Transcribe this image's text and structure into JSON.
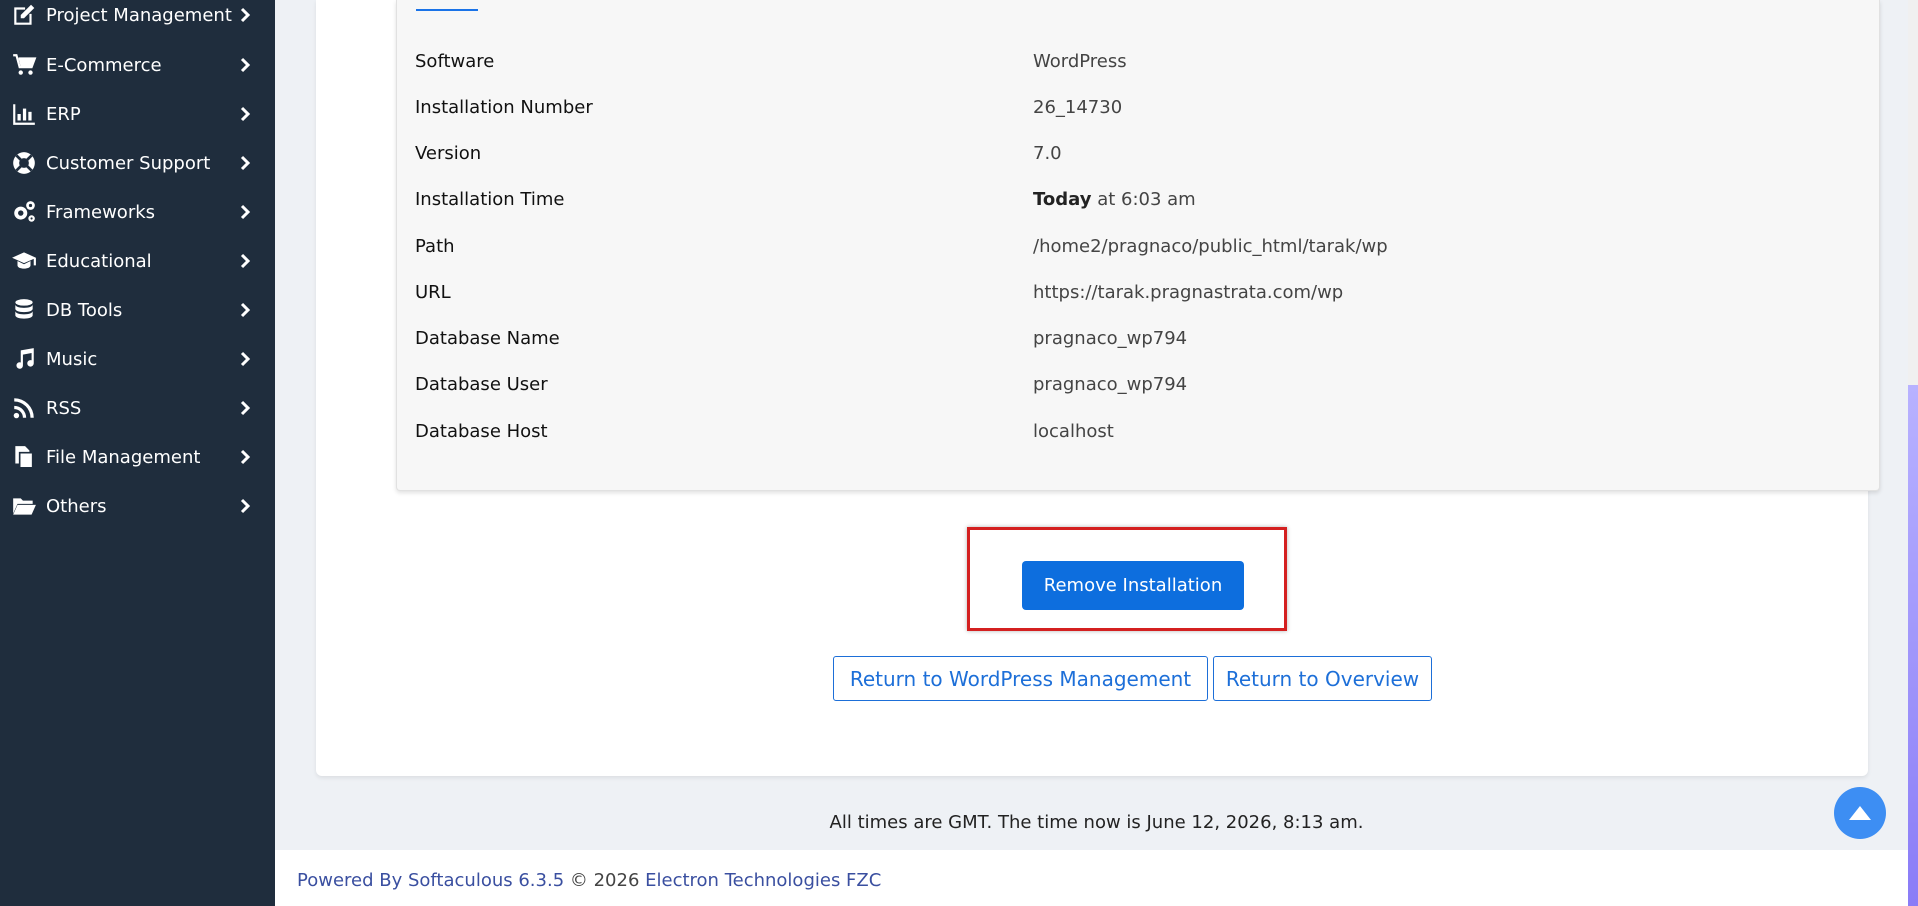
{
  "sidebar": {
    "items": [
      {
        "label": "Project Management",
        "icon": "edit-icon"
      },
      {
        "label": "E-Commerce",
        "icon": "cart-icon"
      },
      {
        "label": "ERP",
        "icon": "bar-chart-icon"
      },
      {
        "label": "Customer Support",
        "icon": "lifebuoy-icon"
      },
      {
        "label": "Frameworks",
        "icon": "gears-icon"
      },
      {
        "label": "Educational",
        "icon": "graduation-cap-icon"
      },
      {
        "label": "DB Tools",
        "icon": "database-icon"
      },
      {
        "label": "Music",
        "icon": "music-icon"
      },
      {
        "label": "RSS",
        "icon": "rss-icon"
      },
      {
        "label": "File Management",
        "icon": "files-icon"
      },
      {
        "label": "Others",
        "icon": "folder-open-icon"
      }
    ]
  },
  "details": {
    "rows": [
      {
        "key": "Software",
        "value": "WordPress"
      },
      {
        "key": "Installation Number",
        "value": "26_14730"
      },
      {
        "key": "Version",
        "value": "7.0"
      },
      {
        "key": "Installation Time",
        "value_bold": "Today",
        "value": " at 6:03 am"
      },
      {
        "key": "Path",
        "value": "/home2/pragnaco/public_html/tarak/wp"
      },
      {
        "key": "URL",
        "value": "https://tarak.pragnastrata.com/wp"
      },
      {
        "key": "Database Name",
        "value": "pragnaco_wp794"
      },
      {
        "key": "Database User",
        "value": "pragnaco_wp794"
      },
      {
        "key": "Database Host",
        "value": "localhost"
      }
    ]
  },
  "actions": {
    "remove_label": "Remove Installation",
    "return_wp_label": "Return to WordPress Management",
    "return_overview_label": "Return to Overview"
  },
  "times_note": "All times are GMT. The time now is June 12, 2026, 8:13 am.",
  "footer": {
    "powered_by": "Powered By Softaculous 6.3.5",
    "copyright": " © 2026 ",
    "company": "Electron Technologies FZC"
  },
  "colors": {
    "sidebar_bg": "#1f2d3d",
    "primary": "#0d6ede",
    "highlight": "#d42020",
    "link": "#3a4fa0"
  }
}
